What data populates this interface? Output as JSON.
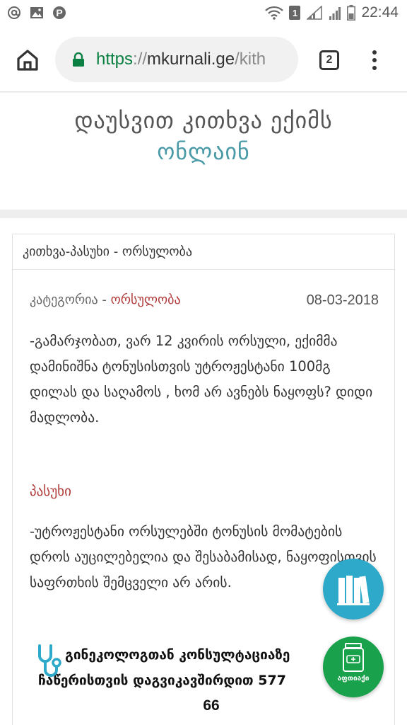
{
  "status_bar": {
    "time": "22:44",
    "left_icons": [
      "at-icon",
      "image-icon",
      "pinterest-icon"
    ],
    "right_icons": [
      "wifi-icon",
      "sim-1-icon",
      "signal-icon",
      "signal-icon",
      "battery-icon"
    ],
    "sim_badge": "1"
  },
  "browser": {
    "url_scheme": "https",
    "url_sep": "://",
    "url_host": "mkurnali.ge",
    "url_path": "/kith",
    "tab_count": "2",
    "accent": "#0b8043"
  },
  "hero": {
    "line1": "დაუსვით კითხვა ექიმს",
    "line2": "ონლაინ"
  },
  "card": {
    "header": "კითხვა-პასუხი - ორსულობა",
    "category_label": "კატეგორია - ",
    "category_value": "ორსულობა",
    "date": "08-03-2018",
    "question": "-გამარჯობათ, ვარ 12 კვირის ორსული, ექიმმა დამინიშნა ტონუსისთვის უტროჟესტანი 100მგ დილას და საღამოს , ხომ არ ავნებს ნაყოფს? დიდი მადლობა.",
    "answer_title": "პასუხი",
    "answer": "-უტროჟესტანი ორსულებში ტონუსის მომატების დროს აუცილებელია და შესაბამისად, ნაყოფისთვის საფრთხის შემცველი არ არის.",
    "contact_line1": "გინეკოლოგთან კონსულტაციაზე",
    "contact_line2": "ჩაწერისთვის დაგვიკავშირდით 577",
    "contact_line3": "66"
  },
  "fabs": {
    "books_color": "#2ea9c9",
    "pharmacy_color": "#19a14b",
    "pharmacy_label": "აფთიაქი"
  },
  "colors": {
    "link_red": "#b03a3a",
    "hero_teal": "#4a9aa8"
  }
}
